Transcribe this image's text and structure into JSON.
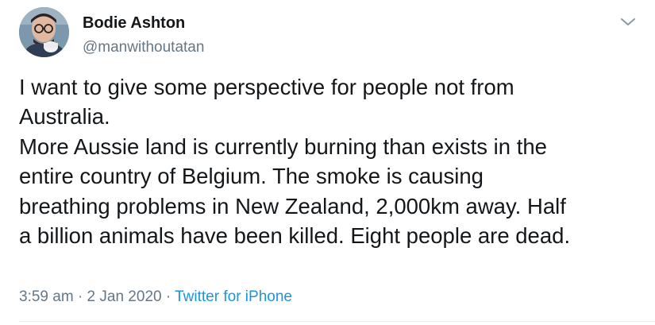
{
  "author": {
    "name": "Bodie Ashton",
    "handle": "@manwithoutatan"
  },
  "tweet": {
    "lines": [
      "I want to give some perspective for people not from",
      "Australia.",
      "More Aussie land is currently burning than exists in the",
      "entire country of Belgium. The smoke is causing",
      "breathing problems in New Zealand, 2,000km away. Half",
      "a billion animals have been killed. Eight people are dead."
    ]
  },
  "meta": {
    "time": "3:59 am",
    "separator": "·",
    "date": "2 Jan 2020",
    "source": "Twitter for iPhone"
  },
  "icons": {
    "menu": "chevron-down-icon"
  },
  "colors": {
    "text": "#14171a",
    "secondary": "#657786",
    "link": "#1b95e0",
    "divider": "#e6ecf0"
  }
}
